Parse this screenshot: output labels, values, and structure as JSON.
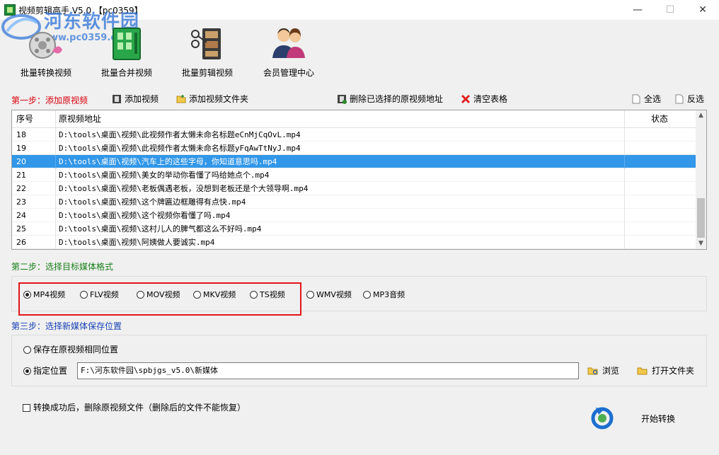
{
  "window": {
    "title": "视频剪辑高手 V5.0 【pc0359】",
    "minimize": "—",
    "maximize": "☐",
    "close": "✕"
  },
  "watermark": {
    "text": "河东软件园",
    "url": "www.pc0359.cn"
  },
  "toolbar": [
    {
      "label": "批量转换视频",
      "icon": "convert-video-icon"
    },
    {
      "label": "批量合并视频",
      "icon": "merge-video-icon"
    },
    {
      "label": "批量剪辑视频",
      "icon": "cut-video-icon"
    },
    {
      "label": "会员管理中心",
      "icon": "members-icon"
    }
  ],
  "step1": {
    "label": "第一步：添加原视频",
    "add_video": "添加视频",
    "add_folder": "添加视频文件夹",
    "delete_selected": "删除已选择的原视频地址",
    "clear_table": "清空表格",
    "select_all": "全选",
    "invert_select": "反选"
  },
  "table": {
    "columns": [
      "序号",
      "原视频地址",
      "状态"
    ],
    "selected_index": 2,
    "rows": [
      {
        "no": "18",
        "path": "D:\\tools\\桌面\\视频\\此视频作者太懒未命名标题eCnMjCqOvL.mp4",
        "status": ""
      },
      {
        "no": "19",
        "path": "D:\\tools\\桌面\\视频\\此视频作者太懒未命名标题yFqAwTtNyJ.mp4",
        "status": ""
      },
      {
        "no": "20",
        "path": "D:\\tools\\桌面\\视频\\汽车上的这些字母，你知道意思吗.mp4",
        "status": ""
      },
      {
        "no": "21",
        "path": "D:\\tools\\桌面\\视频\\美女的举动你看懂了吗给她点个.mp4",
        "status": ""
      },
      {
        "no": "22",
        "path": "D:\\tools\\桌面\\视频\\老板偶遇老板，没想到老板还是个大领导啊.mp4",
        "status": ""
      },
      {
        "no": "23",
        "path": "D:\\tools\\桌面\\视频\\这个牌匾边框雕得有点快.mp4",
        "status": ""
      },
      {
        "no": "24",
        "path": "D:\\tools\\桌面\\视频\\这个视频你看懂了吗.mp4",
        "status": ""
      },
      {
        "no": "25",
        "path": "D:\\tools\\桌面\\视频\\这村儿人的脾气都这么不好吗.mp4",
        "status": ""
      },
      {
        "no": "26",
        "path": "D:\\tools\\桌面\\视频\\阿姨做人要诚实.mp4",
        "status": ""
      }
    ]
  },
  "step2": {
    "label": "第二步：选择目标媒体格式",
    "selected": "MP4视频",
    "formats": [
      "MP4视频",
      "FLV视频",
      "MOV视频",
      "MKV视频",
      "TS视频",
      "WMV视频",
      "MP3音频"
    ]
  },
  "step3": {
    "label": "第三步：选择新媒体保存位置",
    "option_same": "保存在原视频相同位置",
    "option_custom": "指定位置",
    "path_value": "F:\\河东软件园\\spbjgs_v5.0\\新媒体",
    "browse": "浏览",
    "open_folder": "打开文件夹"
  },
  "footer": {
    "delete_after": "转换成功后，删除原视频文件（删除后的文件不能恢复）",
    "start": "开始转换"
  },
  "colors": {
    "selection": "#3297e8",
    "step1": "#d9000d",
    "step2": "#1a7f1a",
    "step3": "#1842b5",
    "highlight_box": "#e0151a"
  }
}
